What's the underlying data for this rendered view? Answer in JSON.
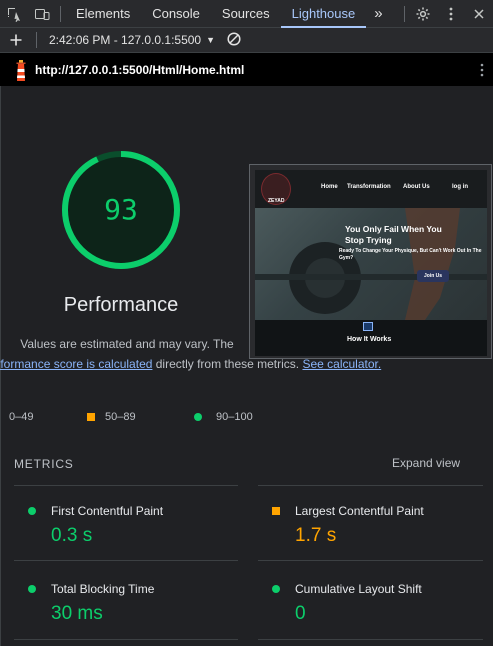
{
  "tabs": [
    {
      "label": "Elements"
    },
    {
      "label": "Console"
    },
    {
      "label": "Sources"
    },
    {
      "label": "Lighthouse"
    }
  ],
  "more_tabs_glyph": "»",
  "toolbar": {
    "report_selector": "2:42:06 PM - 127.0.0.1:5500",
    "add_icon": "plus-icon",
    "clear_icon": "block-icon"
  },
  "url_bar": {
    "url": "http://127.0.0.1:5500/Html/Home.html",
    "logo": "lighthouse-icon"
  },
  "gauge": {
    "score": "93",
    "score_fraction": 0.93,
    "color": "#0cce6b"
  },
  "performance": {
    "title": "Performance",
    "desc_1": "Values are estimated and may vary. The",
    "desc_link_1": "performance score is calculated",
    "desc_2": " directly from these metrics. ",
    "desc_link_2": "See calculator."
  },
  "legend": {
    "poor": "0–49",
    "average": "50–89",
    "good": "90–100",
    "colors": {
      "poor": "#ff4e42",
      "average": "#ffa400",
      "good": "#0cce6b"
    }
  },
  "screenshot": {
    "nav": [
      "Home",
      "Transformation",
      "About Us",
      "log in"
    ],
    "logo_text": "ZEYAD",
    "headline_1": "You Only Fail When You",
    "headline_2": "Stop Trying",
    "subline": "Ready To Change Your Physique, But Can't Work Out In The Gym?",
    "button": "Join Us",
    "section": "How It Works"
  },
  "metrics": {
    "heading": "METRICS",
    "expand": "Expand view",
    "items": [
      {
        "name": "First Contentful Paint",
        "value": "0.3 s",
        "rating": "good"
      },
      {
        "name": "Largest Contentful Paint",
        "value": "1.7 s",
        "rating": "average"
      },
      {
        "name": "Total Blocking Time",
        "value": "30 ms",
        "rating": "good"
      },
      {
        "name": "Cumulative Layout Shift",
        "value": "0",
        "rating": "good"
      }
    ]
  }
}
